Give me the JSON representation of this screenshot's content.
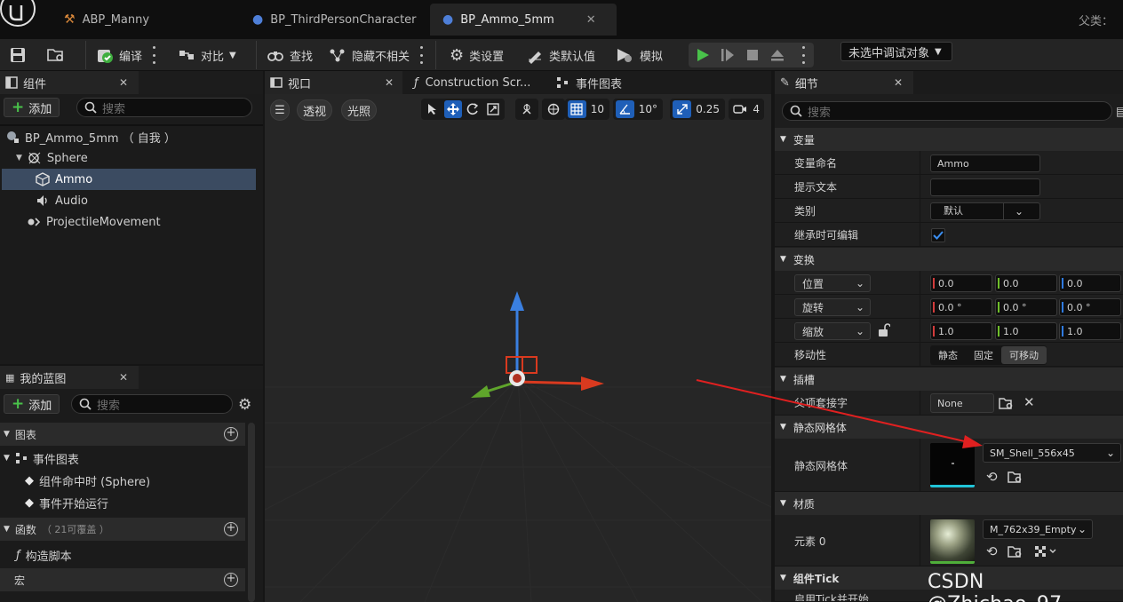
{
  "tabs": [
    {
      "label": "ABP_Manny",
      "active": false
    },
    {
      "label": "BP_ThirdPersonCharacter",
      "active": false
    },
    {
      "label": "BP_Ammo_5mm",
      "active": true
    }
  ],
  "parent_class_label": "父类：",
  "toolbar": {
    "compile": "编译",
    "diff": "对比",
    "find": "查找",
    "hide_unrelated": "隐藏不相关",
    "class_settings": "类设置",
    "class_defaults": "类默认值",
    "simulate": "模拟",
    "debug_object": "未选中调试对象"
  },
  "components": {
    "title": "组件",
    "add": "添加",
    "search_placeholder": "搜索",
    "tree": [
      {
        "label": "BP_Ammo_5mm （ 自我 ）",
        "icon": "actor-icon"
      },
      {
        "label": "Sphere",
        "icon": "collision-sphere-icon"
      },
      {
        "label": "Ammo",
        "icon": "static-mesh-icon",
        "selected": true
      },
      {
        "label": "Audio",
        "icon": "speaker-icon"
      },
      {
        "label": "ProjectileMovement",
        "icon": "movement-icon"
      }
    ]
  },
  "my_blueprint": {
    "title": "我的蓝图",
    "add": "添加",
    "search_placeholder": "搜索",
    "graphs_cat": "图表",
    "event_graph": "事件图表",
    "events": [
      "组件命中时 (Sphere)",
      "事件开始运行"
    ],
    "functions_cat": "函数",
    "functions_note": "（ 21可覆盖 ）",
    "construction_script": "构造脚本",
    "macros_cat": "宏"
  },
  "viewport": {
    "tab": "视口",
    "construction_tab": "Construction Scr...",
    "event_graph_tab": "事件图表",
    "perspective": "透视",
    "lit": "光照",
    "grid_snap": "10",
    "rotate_snap": "10°",
    "scale_snap": "0.25",
    "camera_speed": "4"
  },
  "details": {
    "title": "细节",
    "search_placeholder": "搜索",
    "variable_cat": "变量",
    "var_name_label": "变量命名",
    "var_name_value": "Ammo",
    "tooltip_label": "提示文本",
    "tooltip_value": "",
    "category_label": "类别",
    "category_value": "默认",
    "editable_label": "继承时可编辑",
    "editable_checked": true,
    "transform_cat": "变换",
    "location_label": "位置",
    "location": [
      "0.0",
      "0.0",
      "0.0"
    ],
    "rotation_label": "旋转",
    "rotation": [
      "0.0 °",
      "0.0 °",
      "0.0 °"
    ],
    "scale_label": "缩放",
    "scale": [
      "1.0",
      "1.0",
      "1.0"
    ],
    "mobility_label": "移动性",
    "mobility_options": [
      "静态",
      "固定",
      "可移动"
    ],
    "mobility_selected": "可移动",
    "sockets_cat": "插槽",
    "parent_socket_label": "父项套接字",
    "parent_socket_value": "None",
    "static_mesh_cat": "静态网格体",
    "static_mesh_label": "静态网格体",
    "static_mesh_value": "SM_Shell_556x45",
    "materials_cat": "材质",
    "element0_label": "元素 0",
    "element0_value": "M_762x39_Empty",
    "component_tick_cat": "组件Tick",
    "tick_row_label": "启用Tick并开始"
  },
  "watermark": "CSDN @Zhichao_97",
  "colors": {
    "accent_blue": "#1f5fb8",
    "selection": "#3b4b61",
    "play_green": "#49c24a",
    "arrow_red": "#e02020"
  }
}
